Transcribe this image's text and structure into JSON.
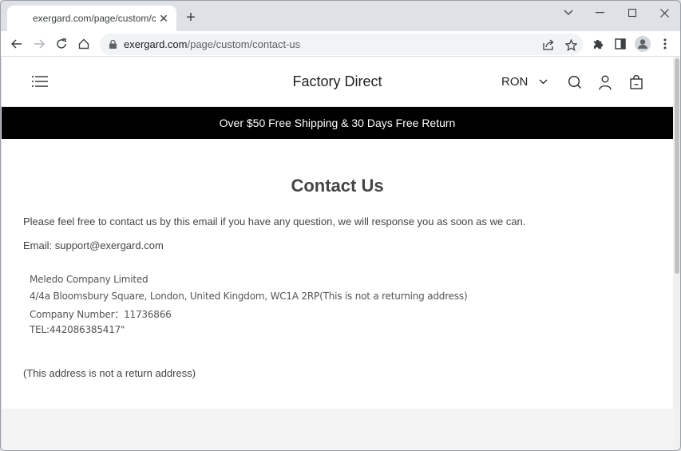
{
  "browser": {
    "tab": {
      "title": "exergard.com/page/custom/contact-us"
    },
    "address_bar": {
      "domain": "exergard.com",
      "path": "/page/custom/contact-us"
    },
    "icons": {
      "back": "arrow-left-icon",
      "forward": "arrow-right-icon",
      "reload": "reload-icon",
      "home": "home-icon",
      "lock": "lock-icon",
      "share": "share-icon",
      "bookmark": "star-icon",
      "extensions": "puzzle-icon",
      "side_panel": "side-panel-icon",
      "profile": "profile-icon",
      "menu": "kebab-menu-icon"
    },
    "glyphs": {
      "close": "✕",
      "new_tab": "+",
      "tab_search": "⌄",
      "minimize": "—",
      "maximize": "☐",
      "window_close": "✕",
      "back": "←",
      "forward": "→",
      "reload": "↻",
      "home": "⌂",
      "bookmark": "☆",
      "menu": "⋮"
    }
  },
  "site": {
    "brand": "Factory Direct",
    "currency": {
      "selected": "RON",
      "chevron": "⌄"
    },
    "announcement": "Over $50 Free Shipping & 30 Days Free Return",
    "accent_color": "#000000"
  },
  "content": {
    "title": "Contact Us",
    "intro": "Please feel free to contact us by this email if you have any question, we will response you as soon as we can.",
    "email_line": "Email: support@exergard.com",
    "address_lines": [
      "Meledo Company Limited",
      "4/4a Bloomsbury Square, London, United Kingdom, WC1A 2RP(This is not a returning address)",
      "Company Number：11736866",
      "TEL:442086385417\""
    ],
    "note": "(This address is not a return address)"
  }
}
